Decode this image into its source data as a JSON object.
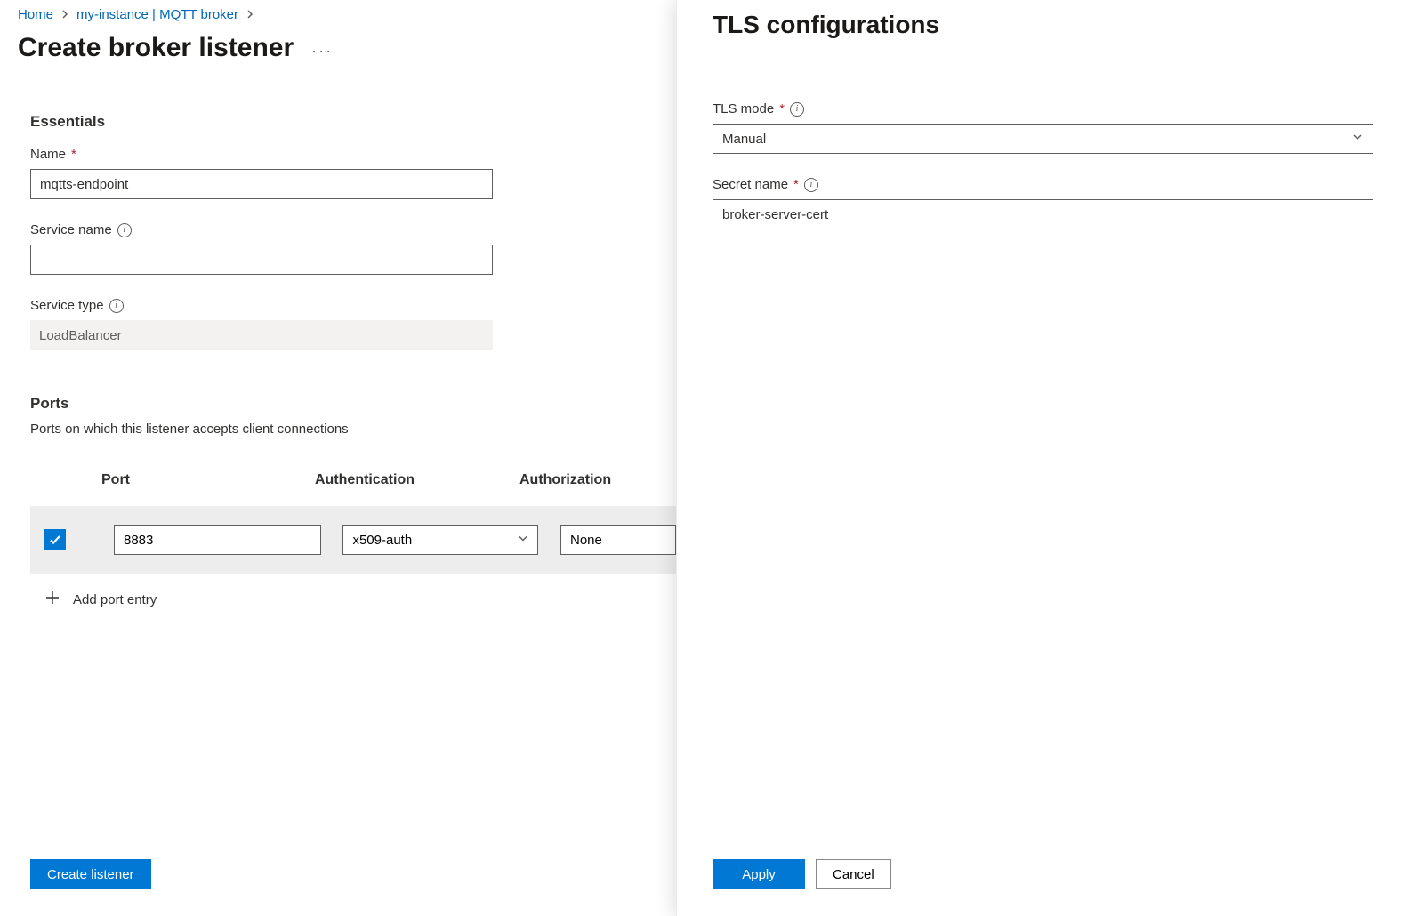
{
  "breadcrumb": {
    "home": "Home",
    "instance": "my-instance | MQTT broker"
  },
  "page_title": "Create broker listener",
  "essentials": {
    "heading": "Essentials",
    "name_label": "Name",
    "name_value": "mqtts-endpoint",
    "service_name_label": "Service name",
    "service_name_value": "",
    "service_type_label": "Service type",
    "service_type_value": "LoadBalancer"
  },
  "ports": {
    "heading": "Ports",
    "description": "Ports on which this listener accepts client connections",
    "columns": {
      "port": "Port",
      "authn": "Authentication",
      "authz": "Authorization"
    },
    "row": {
      "checked": true,
      "port": "8883",
      "authn": "x509-auth",
      "authz": "None"
    },
    "add_label": "Add port entry"
  },
  "footer": {
    "create": "Create listener"
  },
  "panel": {
    "title": "TLS configurations",
    "tls_mode_label": "TLS mode",
    "tls_mode_value": "Manual",
    "secret_name_label": "Secret name",
    "secret_name_value": "broker-server-cert",
    "apply": "Apply",
    "cancel": "Cancel"
  }
}
